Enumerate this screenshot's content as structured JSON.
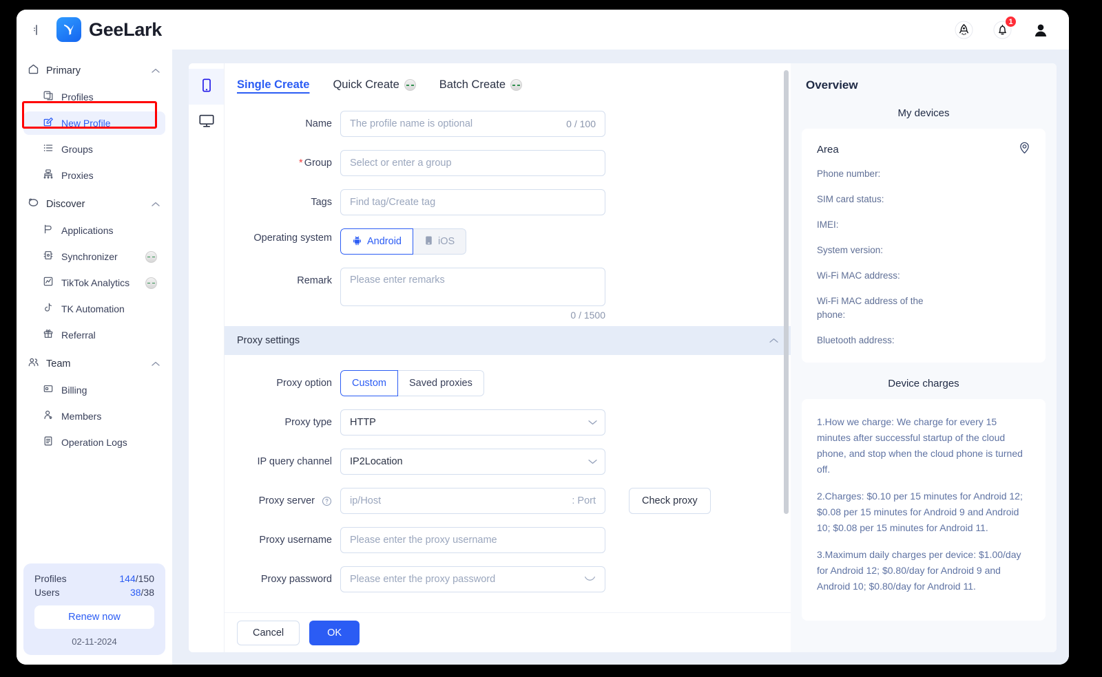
{
  "header": {
    "panel_toggle_icon": "panel-toggle-icon",
    "brand_name": "GeeLark",
    "rocket_icon": "rocket-icon",
    "bell_icon": "bell-icon",
    "notification_count": "1",
    "avatar_icon": "user-avatar-icon"
  },
  "sidebar": {
    "groups": [
      {
        "label": "Primary",
        "icon": "home-icon",
        "chevron": "chevron-up-icon",
        "items": [
          {
            "label": "Profiles",
            "icon": "profiles-icon",
            "active": false,
            "badge": false
          },
          {
            "label": "New Profile",
            "icon": "new-profile-icon",
            "active": true,
            "badge": false
          },
          {
            "label": "Groups",
            "icon": "groups-list-icon",
            "active": false,
            "badge": false
          },
          {
            "label": "Proxies",
            "icon": "proxies-network-icon",
            "active": false,
            "badge": false
          }
        ]
      },
      {
        "label": "Discover",
        "icon": "discover-icon",
        "chevron": "chevron-up-icon",
        "items": [
          {
            "label": "Applications",
            "icon": "applications-icon",
            "active": false,
            "badge": false
          },
          {
            "label": "Synchronizer",
            "icon": "synchronizer-icon",
            "active": false,
            "badge": true
          },
          {
            "label": "TikTok Analytics",
            "icon": "analytics-chart-icon",
            "active": false,
            "badge": true
          },
          {
            "label": "TK Automation",
            "icon": "tiktok-note-icon",
            "active": false,
            "badge": false
          },
          {
            "label": "Referral",
            "icon": "gift-icon",
            "active": false,
            "badge": false
          }
        ]
      },
      {
        "label": "Team",
        "icon": "team-people-icon",
        "chevron": "chevron-up-icon",
        "items": [
          {
            "label": "Billing",
            "icon": "billing-card-icon",
            "active": false,
            "badge": false
          },
          {
            "label": "Members",
            "icon": "member-person-icon",
            "active": false,
            "badge": false
          },
          {
            "label": "Operation Logs",
            "icon": "operation-logs-icon",
            "active": false,
            "badge": false
          }
        ]
      }
    ],
    "footer": {
      "profiles_label": "Profiles",
      "profiles_used": "144",
      "profiles_total": "/150",
      "users_label": "Users",
      "users_used": "38",
      "users_total": "/38",
      "renew_label": "Renew now",
      "expiry_date": "02-11-2024"
    }
  },
  "form": {
    "device_rail": [
      {
        "icon": "mobile-phone-icon",
        "active": true
      },
      {
        "icon": "desktop-monitor-icon",
        "active": false
      }
    ],
    "tabs": [
      {
        "label": "Single Create",
        "active": true,
        "badge": false
      },
      {
        "label": "Quick Create",
        "active": false,
        "badge": true
      },
      {
        "label": "Batch Create",
        "active": false,
        "badge": true
      }
    ],
    "fields": {
      "name_label": "Name",
      "name_placeholder": "The profile name is optional",
      "name_counter": "0 / 100",
      "group_label": "Group",
      "group_required": "*",
      "group_placeholder": "Select or enter a group",
      "tags_label": "Tags",
      "tags_placeholder": "Find tag/Create tag",
      "os_label": "Operating system",
      "os_options": [
        {
          "label": "Android",
          "icon": "android-icon",
          "selected": true
        },
        {
          "label": "iOS",
          "icon": "ios-device-icon",
          "selected": false
        }
      ],
      "remark_label": "Remark",
      "remark_placeholder": "Please enter remarks",
      "remark_counter": "0 / 1500"
    },
    "proxy": {
      "section_title": "Proxy settings",
      "section_chevron": "chevron-up-icon",
      "option_label": "Proxy option",
      "options": [
        {
          "label": "Custom",
          "selected": true
        },
        {
          "label": "Saved proxies",
          "selected": false
        }
      ],
      "type_label": "Proxy type",
      "type_value": "HTTP",
      "ip_channel_label": "IP query channel",
      "ip_channel_value": "IP2Location",
      "server_label": "Proxy server",
      "server_help_icon": "question-circle-icon",
      "server_placeholder": "ip/Host",
      "server_port_placeholder": ": Port",
      "check_proxy_label": "Check proxy",
      "username_label": "Proxy username",
      "username_placeholder": "Please enter the proxy username",
      "password_label": "Proxy password",
      "password_placeholder": "Please enter the proxy password",
      "password_eye_icon": "eye-slash-icon"
    },
    "footer": {
      "cancel_label": "Cancel",
      "ok_label": "OK"
    }
  },
  "overview": {
    "title": "Overview",
    "devices_section_title": "My devices",
    "device_card": {
      "area_label": "Area",
      "location_icon": "location-pin-icon",
      "fields": [
        "Phone number:",
        "SIM card status:",
        "IMEI:",
        "System version:",
        "Wi-Fi MAC address:",
        "Wi-Fi MAC address of the phone:",
        "Bluetooth address:"
      ]
    },
    "charges_section_title": "Device charges",
    "charges_paragraphs": [
      "1.How we charge: We charge for every 15 minutes after successful startup of the cloud phone, and stop when the cloud phone is turned off.",
      "2.Charges: $0.10 per 15 minutes for Android 12; $0.08 per 15 minutes for Android 9 and Android 10; $0.08 per 15 minutes for Android 11.",
      "3.Maximum daily charges per device: $1.00/day for Android 12; $0.80/day for Android 9 and Android 10; $0.80/day for Android 11."
    ]
  },
  "colors": {
    "accent": "#2b5cf4",
    "annotation": "#ff0000",
    "badge_red": "#ff2d37",
    "page_bg": "#eaeff8"
  }
}
